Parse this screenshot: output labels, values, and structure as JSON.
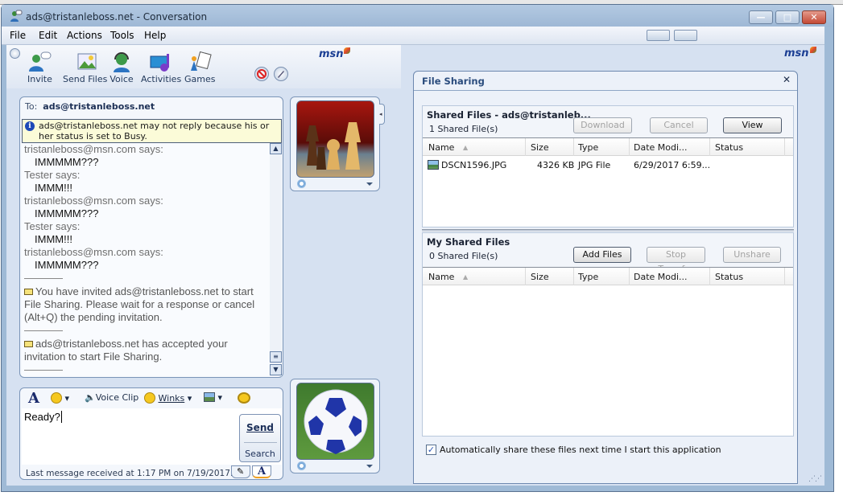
{
  "window": {
    "title": "ads@tristanleboss.net - Conversation",
    "controls": {
      "minimize": "minimize",
      "maximize": "maximize",
      "close": "close"
    }
  },
  "menu": [
    "File",
    "Edit",
    "Actions",
    "Tools",
    "Help"
  ],
  "toolbar": {
    "items": [
      {
        "label": "Invite",
        "icon": "invite-icon"
      },
      {
        "label": "Send Files",
        "icon": "send-files-icon"
      },
      {
        "label": "Voice",
        "icon": "voice-icon"
      },
      {
        "label": "Activities",
        "icon": "activities-icon"
      },
      {
        "label": "Games",
        "icon": "games-icon"
      }
    ],
    "brand": "msn"
  },
  "conversation": {
    "to_label": "To:",
    "to_contact": "ads@tristanleboss.net",
    "notice": "ads@tristanleboss.net may not reply because his or her status is set to Busy.",
    "messages": [
      {
        "who": "tristanleboss@msn.com says:",
        "text": "IMMMMM???"
      },
      {
        "who": "Tester says:",
        "text": "IMMM!!!"
      },
      {
        "who": "tristanleboss@msn.com says:",
        "text": "IMMMMM???"
      },
      {
        "who": "Tester says:",
        "text": "IMMM!!!"
      },
      {
        "who": "tristanleboss@msn.com says:",
        "text": "IMMMMM???"
      }
    ],
    "system_messages": [
      "You have invited ads@tristanleboss.net to start File Sharing. Please wait for a response or cancel (Alt+Q) the pending invitation.",
      "ads@tristanleboss.net has accepted your invitation to start File Sharing."
    ]
  },
  "composer": {
    "toolbar": {
      "font": "A",
      "voice_clip": "Voice Clip",
      "winks": "Winks"
    },
    "input_value": "Ready?",
    "send_label": "Send",
    "search_label": "Search",
    "status": "Last message received at 1:17 PM on 7/19/2017."
  },
  "file_sharing": {
    "title": "File Sharing",
    "shared": {
      "title": "Shared Files - ads@tristanleb...",
      "count": "1 Shared File(s)",
      "buttons": {
        "download": "Download",
        "cancel": "Cancel",
        "view": "View"
      },
      "columns": [
        "Name",
        "Size",
        "Type",
        "Date Modi...",
        "Status"
      ],
      "rows": [
        {
          "name": "DSCN1596.JPG",
          "size": "4326 KB",
          "type": "JPG File",
          "date": "6/29/2017 6:59...",
          "status": ""
        }
      ]
    },
    "mine": {
      "title": "My Shared Files",
      "count": "0 Shared File(s)",
      "buttons": {
        "add": "Add Files",
        "stop": "Stop Transfer",
        "unshare": "Unshare"
      },
      "columns": [
        "Name",
        "Size",
        "Type",
        "Date Modi...",
        "Status"
      ]
    },
    "auto_share_label": "Automatically share these files next time I start this application",
    "auto_share_checked": true
  }
}
